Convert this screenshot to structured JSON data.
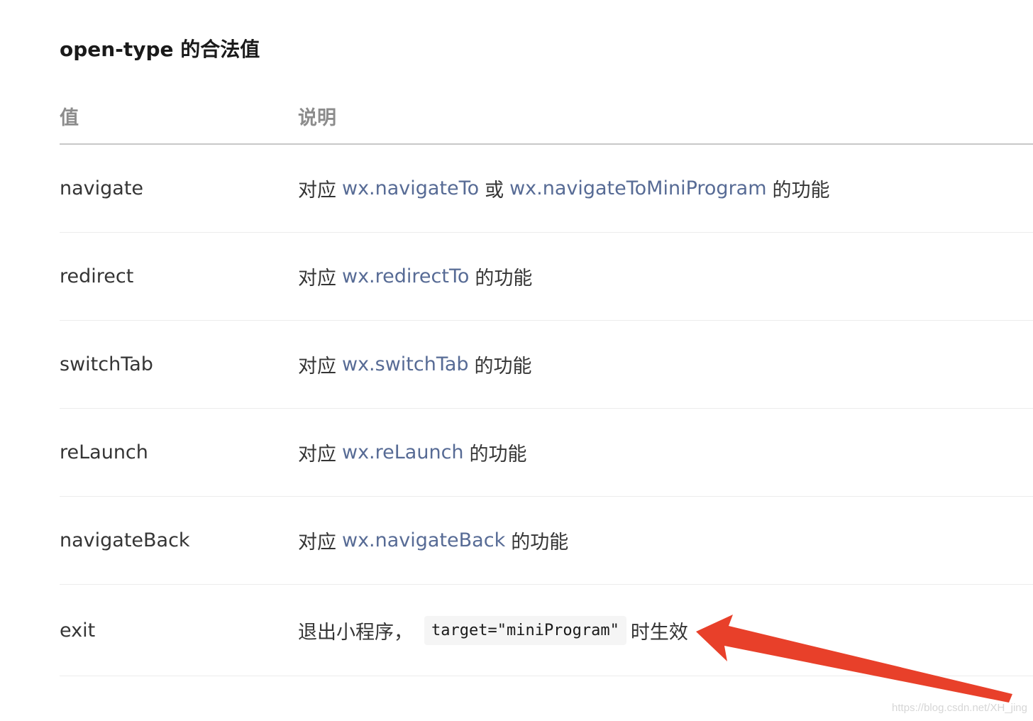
{
  "title": "open-type 的合法值",
  "table": {
    "headers": {
      "value": "值",
      "description": "说明"
    },
    "rows": [
      {
        "value": "navigate",
        "parts": [
          {
            "t": "text",
            "v": "对应"
          },
          {
            "t": "link",
            "v": "wx.navigateTo"
          },
          {
            "t": "text",
            "v": "或"
          },
          {
            "t": "link",
            "v": "wx.navigateToMiniProgram"
          },
          {
            "t": "text",
            "v": "的功能"
          }
        ]
      },
      {
        "value": "redirect",
        "parts": [
          {
            "t": "text",
            "v": "对应"
          },
          {
            "t": "link",
            "v": "wx.redirectTo"
          },
          {
            "t": "text",
            "v": "的功能"
          }
        ]
      },
      {
        "value": "switchTab",
        "parts": [
          {
            "t": "text",
            "v": "对应"
          },
          {
            "t": "link",
            "v": "wx.switchTab"
          },
          {
            "t": "text",
            "v": "的功能"
          }
        ]
      },
      {
        "value": "reLaunch",
        "parts": [
          {
            "t": "text",
            "v": "对应"
          },
          {
            "t": "link",
            "v": "wx.reLaunch"
          },
          {
            "t": "text",
            "v": "的功能"
          }
        ]
      },
      {
        "value": "navigateBack",
        "parts": [
          {
            "t": "text",
            "v": "对应"
          },
          {
            "t": "link",
            "v": "wx.navigateBack"
          },
          {
            "t": "text",
            "v": "的功能"
          }
        ]
      },
      {
        "value": "exit",
        "parts": [
          {
            "t": "text",
            "v": "退出小程序，"
          },
          {
            "t": "code",
            "v": "target=\"miniProgram\""
          },
          {
            "t": "text",
            "v": "时生效"
          }
        ]
      }
    ]
  },
  "annotation": {
    "icon": "red-arrow-icon",
    "color": "#e8402a"
  },
  "watermark": "https://blog.csdn.net/XH_jing",
  "colors": {
    "link": "#576b95",
    "header": "#8c8c8c",
    "text": "#353535"
  }
}
